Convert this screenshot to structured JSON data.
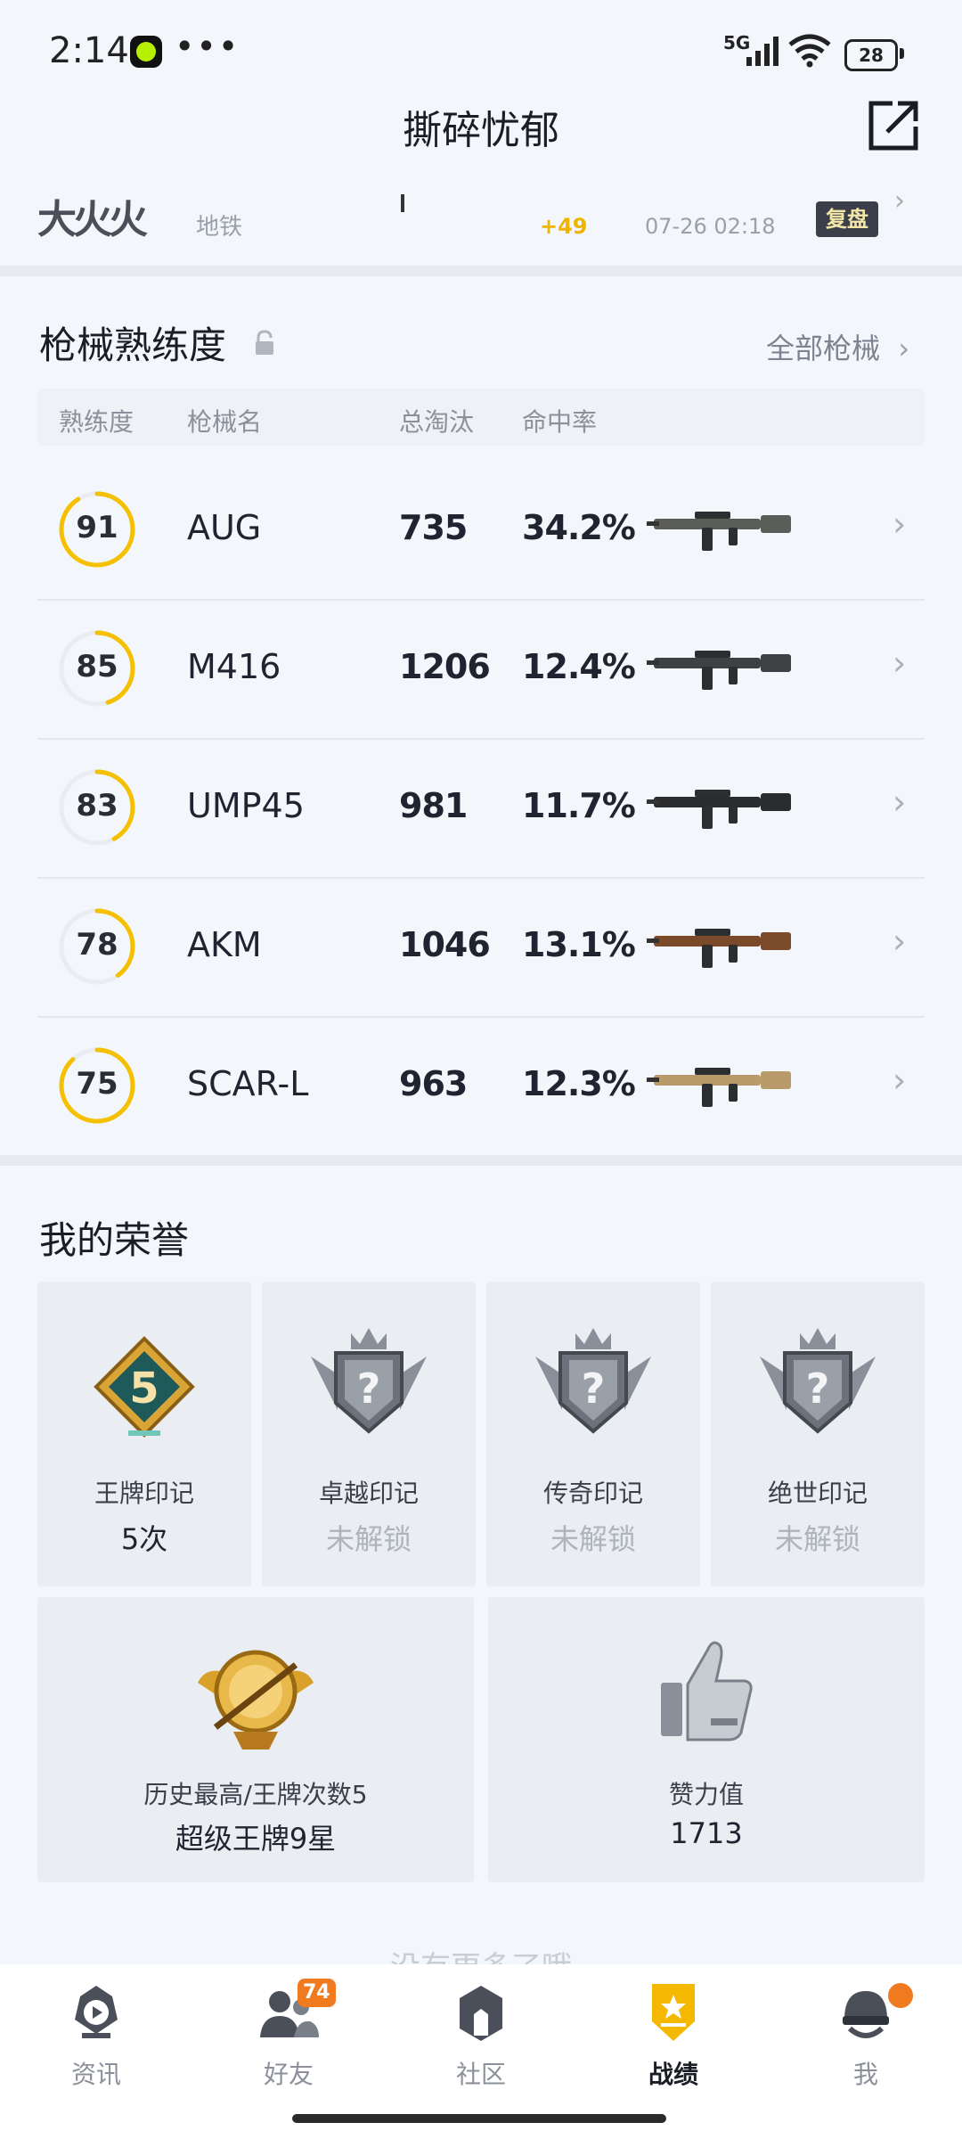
{
  "status_bar": {
    "time": "2:14",
    "more": "•••",
    "network": "5G",
    "battery": "28"
  },
  "header": {
    "title": "撕碎忧郁",
    "share_icon": "external-share-icon"
  },
  "match": {
    "logo": "大火火",
    "mode": "地铁",
    "score": "+49",
    "datetime": "07-26 02:18",
    "review": "复盘"
  },
  "weapons": {
    "title": "枪械熟练度",
    "all_link": "全部枪械",
    "columns": [
      "熟练度",
      "枪械名",
      "总淘汰",
      "命中率"
    ],
    "rows": [
      {
        "mastery": "91",
        "name": "AUG",
        "kills": "735",
        "accuracy": "34.2%",
        "progress": 0.91,
        "color": "#f5c000"
      },
      {
        "mastery": "85",
        "name": "M416",
        "kills": "1206",
        "accuracy": "12.4%",
        "progress": 0.45,
        "color": "#f5c000"
      },
      {
        "mastery": "83",
        "name": "UMP45",
        "kills": "981",
        "accuracy": "11.7%",
        "progress": 0.42,
        "color": "#f5c000"
      },
      {
        "mastery": "78",
        "name": "AKM",
        "kills": "1046",
        "accuracy": "13.1%",
        "progress": 0.4,
        "color": "#f5c000"
      },
      {
        "mastery": "75",
        "name": "SCAR-L",
        "kills": "963",
        "accuracy": "12.3%",
        "progress": 0.88,
        "color": "#f5c000"
      }
    ]
  },
  "honors": {
    "title": "我的荣誉",
    "marks": [
      {
        "label": "王牌印记",
        "value": "5次",
        "locked": false,
        "badge_text": "5"
      },
      {
        "label": "卓越印记",
        "value": "未解锁",
        "locked": true,
        "badge_text": "?"
      },
      {
        "label": "传奇印记",
        "value": "未解锁",
        "locked": true,
        "badge_text": "?"
      },
      {
        "label": "绝世印记",
        "value": "未解锁",
        "locked": true,
        "badge_text": "?"
      }
    ],
    "highest": {
      "label": "历史最高/王牌次数5",
      "value": "超级王牌9星"
    },
    "likes": {
      "label": "赞力值",
      "value": "1713"
    }
  },
  "no_more": "没有更多了哦",
  "nav": {
    "items": [
      {
        "label": "资讯",
        "icon": "news-icon"
      },
      {
        "label": "好友",
        "icon": "friends-icon",
        "badge": "74"
      },
      {
        "label": "社区",
        "icon": "community-icon"
      },
      {
        "label": "战绩",
        "icon": "record-icon",
        "active": true
      },
      {
        "label": "我",
        "icon": "profile-icon"
      }
    ]
  },
  "colors": {
    "accent": "#f5c000",
    "orange_badge": "#f07a20"
  }
}
